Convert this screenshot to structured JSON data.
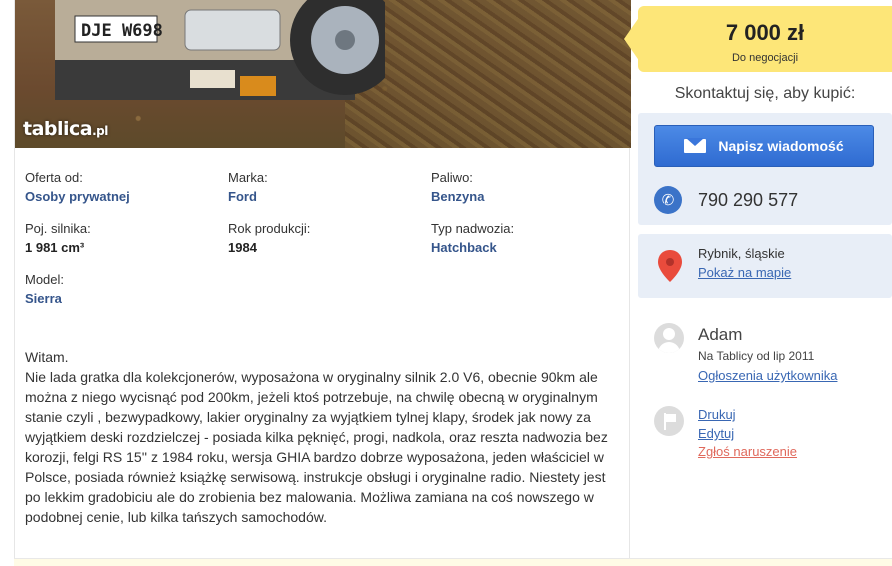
{
  "photo": {
    "watermark": "tablica",
    "watermark_suffix": ".pl",
    "plate": "DJE W698"
  },
  "params": [
    {
      "label": "Oferta od:",
      "value": "Osoby prywatnej"
    },
    {
      "label": "Marka:",
      "value": "Ford"
    },
    {
      "label": "Paliwo:",
      "value": "Benzyna"
    },
    {
      "label": "Poj. silnika:",
      "value": "1 981 cm³"
    },
    {
      "label": "Rok produkcji:",
      "value": "1984"
    },
    {
      "label": "Typ nadwozia:",
      "value": "Hatchback"
    },
    {
      "label": "Model:",
      "value": "Sierra"
    }
  ],
  "description": "Witam.\nNie lada gratka dla kolekcjonerów, wyposażona w oryginalny silnik 2.0 V6, obecnie 90km ale można z niego wycisnąć pod 200km, jeżeli ktoś potrzebuje, na chwilę obecną w oryginalnym stanie czyli , bezwypadkowy, lakier oryginalny za wyjątkiem tylnej klapy, środek jak nowy za wyjątkiem deski rozdzielczej - posiada kilka pęknięć, progi, nadkola, oraz reszta nadwozia bez korozji, felgi RS 15'' z 1984 roku, wersja GHIA bardzo dobrze wyposażona, jeden właściciel w Polsce, posiada również książkę serwisową. instrukcje obsługi i oryginalne radio. Niestety jest po lekkim gradobiciu ale do zrobienia bez malowania. Możliwa zamiana na coś nowszego w podobnej cenie, lub kilka tańszych samochodów.",
  "price": {
    "amount": "7 000 zł",
    "note": "Do negocjacji"
  },
  "contact": {
    "heading": "Skontaktuj się, aby kupić:",
    "message_button": "Napisz wiadomość",
    "phone": "790 290 577"
  },
  "location": {
    "city": "Rybnik, śląskie",
    "map_link": "Pokaż na mapie"
  },
  "user": {
    "name": "Adam",
    "since": "Na Tablicy od lip 2011",
    "ads_link": "Ogłoszenia użytkownika"
  },
  "actions": {
    "print": "Drukuj",
    "edit": "Edytuj",
    "report": "Zgłoś naruszenie"
  },
  "colors": {
    "price_bg": "#fde678",
    "link": "#3967b3",
    "button": "#2f6bd1",
    "report": "#e0695c",
    "panel": "#e8eef7"
  },
  "icons": [
    "envelope-icon",
    "phone-icon",
    "map-pin-icon",
    "user-avatar-icon",
    "flag-icon"
  ]
}
